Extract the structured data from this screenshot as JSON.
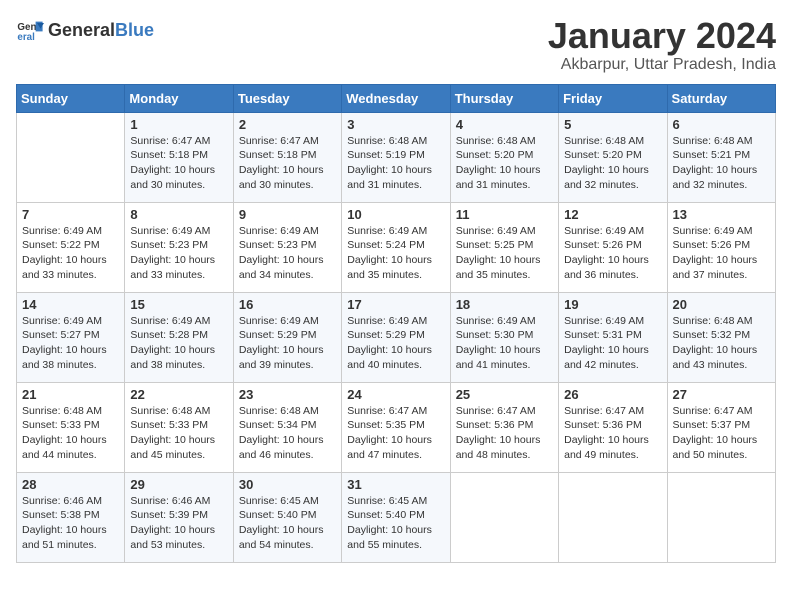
{
  "header": {
    "logo_general": "General",
    "logo_blue": "Blue",
    "month_year": "January 2024",
    "location": "Akbarpur, Uttar Pradesh, India"
  },
  "weekdays": [
    "Sunday",
    "Monday",
    "Tuesday",
    "Wednesday",
    "Thursday",
    "Friday",
    "Saturday"
  ],
  "weeks": [
    [
      {
        "day": "",
        "sunrise": "",
        "sunset": "",
        "daylight": ""
      },
      {
        "day": "1",
        "sunrise": "Sunrise: 6:47 AM",
        "sunset": "Sunset: 5:18 PM",
        "daylight": "Daylight: 10 hours and 30 minutes."
      },
      {
        "day": "2",
        "sunrise": "Sunrise: 6:47 AM",
        "sunset": "Sunset: 5:18 PM",
        "daylight": "Daylight: 10 hours and 30 minutes."
      },
      {
        "day": "3",
        "sunrise": "Sunrise: 6:48 AM",
        "sunset": "Sunset: 5:19 PM",
        "daylight": "Daylight: 10 hours and 31 minutes."
      },
      {
        "day": "4",
        "sunrise": "Sunrise: 6:48 AM",
        "sunset": "Sunset: 5:20 PM",
        "daylight": "Daylight: 10 hours and 31 minutes."
      },
      {
        "day": "5",
        "sunrise": "Sunrise: 6:48 AM",
        "sunset": "Sunset: 5:20 PM",
        "daylight": "Daylight: 10 hours and 32 minutes."
      },
      {
        "day": "6",
        "sunrise": "Sunrise: 6:48 AM",
        "sunset": "Sunset: 5:21 PM",
        "daylight": "Daylight: 10 hours and 32 minutes."
      }
    ],
    [
      {
        "day": "7",
        "sunrise": "Sunrise: 6:49 AM",
        "sunset": "Sunset: 5:22 PM",
        "daylight": "Daylight: 10 hours and 33 minutes."
      },
      {
        "day": "8",
        "sunrise": "Sunrise: 6:49 AM",
        "sunset": "Sunset: 5:23 PM",
        "daylight": "Daylight: 10 hours and 33 minutes."
      },
      {
        "day": "9",
        "sunrise": "Sunrise: 6:49 AM",
        "sunset": "Sunset: 5:23 PM",
        "daylight": "Daylight: 10 hours and 34 minutes."
      },
      {
        "day": "10",
        "sunrise": "Sunrise: 6:49 AM",
        "sunset": "Sunset: 5:24 PM",
        "daylight": "Daylight: 10 hours and 35 minutes."
      },
      {
        "day": "11",
        "sunrise": "Sunrise: 6:49 AM",
        "sunset": "Sunset: 5:25 PM",
        "daylight": "Daylight: 10 hours and 35 minutes."
      },
      {
        "day": "12",
        "sunrise": "Sunrise: 6:49 AM",
        "sunset": "Sunset: 5:26 PM",
        "daylight": "Daylight: 10 hours and 36 minutes."
      },
      {
        "day": "13",
        "sunrise": "Sunrise: 6:49 AM",
        "sunset": "Sunset: 5:26 PM",
        "daylight": "Daylight: 10 hours and 37 minutes."
      }
    ],
    [
      {
        "day": "14",
        "sunrise": "Sunrise: 6:49 AM",
        "sunset": "Sunset: 5:27 PM",
        "daylight": "Daylight: 10 hours and 38 minutes."
      },
      {
        "day": "15",
        "sunrise": "Sunrise: 6:49 AM",
        "sunset": "Sunset: 5:28 PM",
        "daylight": "Daylight: 10 hours and 38 minutes."
      },
      {
        "day": "16",
        "sunrise": "Sunrise: 6:49 AM",
        "sunset": "Sunset: 5:29 PM",
        "daylight": "Daylight: 10 hours and 39 minutes."
      },
      {
        "day": "17",
        "sunrise": "Sunrise: 6:49 AM",
        "sunset": "Sunset: 5:29 PM",
        "daylight": "Daylight: 10 hours and 40 minutes."
      },
      {
        "day": "18",
        "sunrise": "Sunrise: 6:49 AM",
        "sunset": "Sunset: 5:30 PM",
        "daylight": "Daylight: 10 hours and 41 minutes."
      },
      {
        "day": "19",
        "sunrise": "Sunrise: 6:49 AM",
        "sunset": "Sunset: 5:31 PM",
        "daylight": "Daylight: 10 hours and 42 minutes."
      },
      {
        "day": "20",
        "sunrise": "Sunrise: 6:48 AM",
        "sunset": "Sunset: 5:32 PM",
        "daylight": "Daylight: 10 hours and 43 minutes."
      }
    ],
    [
      {
        "day": "21",
        "sunrise": "Sunrise: 6:48 AM",
        "sunset": "Sunset: 5:33 PM",
        "daylight": "Daylight: 10 hours and 44 minutes."
      },
      {
        "day": "22",
        "sunrise": "Sunrise: 6:48 AM",
        "sunset": "Sunset: 5:33 PM",
        "daylight": "Daylight: 10 hours and 45 minutes."
      },
      {
        "day": "23",
        "sunrise": "Sunrise: 6:48 AM",
        "sunset": "Sunset: 5:34 PM",
        "daylight": "Daylight: 10 hours and 46 minutes."
      },
      {
        "day": "24",
        "sunrise": "Sunrise: 6:47 AM",
        "sunset": "Sunset: 5:35 PM",
        "daylight": "Daylight: 10 hours and 47 minutes."
      },
      {
        "day": "25",
        "sunrise": "Sunrise: 6:47 AM",
        "sunset": "Sunset: 5:36 PM",
        "daylight": "Daylight: 10 hours and 48 minutes."
      },
      {
        "day": "26",
        "sunrise": "Sunrise: 6:47 AM",
        "sunset": "Sunset: 5:36 PM",
        "daylight": "Daylight: 10 hours and 49 minutes."
      },
      {
        "day": "27",
        "sunrise": "Sunrise: 6:47 AM",
        "sunset": "Sunset: 5:37 PM",
        "daylight": "Daylight: 10 hours and 50 minutes."
      }
    ],
    [
      {
        "day": "28",
        "sunrise": "Sunrise: 6:46 AM",
        "sunset": "Sunset: 5:38 PM",
        "daylight": "Daylight: 10 hours and 51 minutes."
      },
      {
        "day": "29",
        "sunrise": "Sunrise: 6:46 AM",
        "sunset": "Sunset: 5:39 PM",
        "daylight": "Daylight: 10 hours and 53 minutes."
      },
      {
        "day": "30",
        "sunrise": "Sunrise: 6:45 AM",
        "sunset": "Sunset: 5:40 PM",
        "daylight": "Daylight: 10 hours and 54 minutes."
      },
      {
        "day": "31",
        "sunrise": "Sunrise: 6:45 AM",
        "sunset": "Sunset: 5:40 PM",
        "daylight": "Daylight: 10 hours and 55 minutes."
      },
      {
        "day": "",
        "sunrise": "",
        "sunset": "",
        "daylight": ""
      },
      {
        "day": "",
        "sunrise": "",
        "sunset": "",
        "daylight": ""
      },
      {
        "day": "",
        "sunrise": "",
        "sunset": "",
        "daylight": ""
      }
    ]
  ]
}
